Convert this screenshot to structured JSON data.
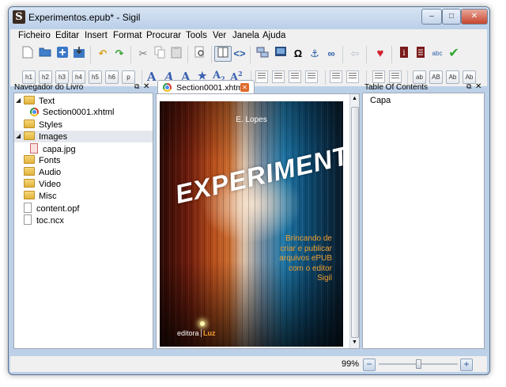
{
  "window": {
    "title": "Experimentos.epub* - Sigil",
    "app_icon": "S"
  },
  "window_controls": {
    "minimize": "–",
    "maximize": "□",
    "close": "✕"
  },
  "menu": [
    "Ficheiro",
    "Editar",
    "Insert",
    "Format",
    "Procurar",
    "Tools",
    "Ver",
    "Janela",
    "Ajuda"
  ],
  "heading_buttons": [
    "h1",
    "h2",
    "h3",
    "h4",
    "h5",
    "h6",
    "p"
  ],
  "case_buttons": [
    "ab",
    "AB",
    "Ab",
    "Ab"
  ],
  "book_browser": {
    "title": "Navegador do Livro",
    "items": [
      {
        "label": "Text"
      },
      {
        "label": "Section0001.xhtml"
      },
      {
        "label": "Styles"
      },
      {
        "label": "Images"
      },
      {
        "label": "capa.jpg"
      },
      {
        "label": "Fonts"
      },
      {
        "label": "Audio"
      },
      {
        "label": "Video"
      },
      {
        "label": "Misc"
      },
      {
        "label": "content.opf"
      },
      {
        "label": "toc.ncx"
      }
    ]
  },
  "editor": {
    "tab_label": "Section0001.xhtml"
  },
  "cover": {
    "author": "E. Lopes",
    "title": "EXPERIMENTOS",
    "subtitle_lines": [
      "Brincando de",
      "criar e publicar",
      "arquivos ePUB",
      "com o editor",
      "Sigil"
    ],
    "publisher_name": "editora",
    "publisher_brand": "Luz"
  },
  "toc": {
    "title": "Table Of Contents",
    "items": [
      "Capa"
    ]
  },
  "status": {
    "zoom": "99%",
    "zoom_level": 0.5
  },
  "colors": {
    "title_bar": "#c4d6ec",
    "accent_orange": "#f0a030",
    "heart": "#d21f2b",
    "check": "#2fa52f"
  }
}
